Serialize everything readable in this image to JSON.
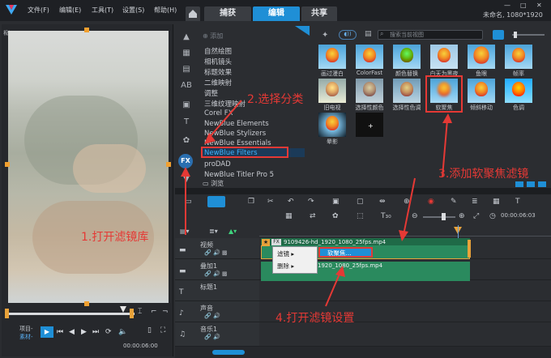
{
  "menu": {
    "file": "文件(F)",
    "edit": "编辑(E)",
    "tools": "工具(T)",
    "settings": "设置(S)",
    "help": "帮助(H)"
  },
  "tabs": [
    "捕获",
    "编辑",
    "共享"
  ],
  "active_tab": "编辑",
  "project_info": "未命名, 1080*1920",
  "preview": {
    "corner_label": "视频层",
    "mode_project": "项目-",
    "mode_clip": "素材-",
    "timecode": "00:00:06:00"
  },
  "library": {
    "add_label": "添加",
    "browse_label": "浏览",
    "search_placeholder": "搜索当前视图",
    "categories": [
      "自然绘图",
      "相机镜头",
      "标题效果",
      "二维映射",
      "调整",
      "三维纹理映射",
      "Corel FX",
      "NewBlue Elements",
      "NewBlue Stylizers",
      "NewBlue Essentials",
      "NewBlue Filters",
      "proDAD",
      "NewBlue Titler Pro 5"
    ],
    "selected_category": "NewBlue Filters",
    "filters": [
      "画过漫白",
      "ColorFast",
      "颜色替换",
      "白天为黑夜",
      "鱼眼",
      "帧率",
      "旧电视",
      "选择性颜色",
      "选择性色调",
      "软聚焦",
      "倾斜移动",
      "色调",
      "晕影",
      ""
    ]
  },
  "timeline": {
    "timecode": "00:00:06:03",
    "tracks": [
      "视频",
      "叠加1",
      "标题1",
      "声音",
      "音乐1"
    ],
    "clip_name": "9109426-hd_1920_1080_25fps.mp4",
    "overlay_clip_name": "1920_1080_25fps.mp4",
    "clip_fx_badge": "FX",
    "context_menu": {
      "filter": "滤镜",
      "delete": "删除",
      "submenu_item": "软聚焦..."
    }
  },
  "annotations": {
    "step1": "1.打开滤镜库",
    "step2": "2.选择分类",
    "step3": "3.添加软聚焦滤镜",
    "step4": "4.打开滤镜设置"
  },
  "colors": {
    "accent": "#1f8fd6",
    "annotation": "#e53935",
    "clip": "#2a8a5e",
    "selected_text": "#3fb4ff"
  }
}
